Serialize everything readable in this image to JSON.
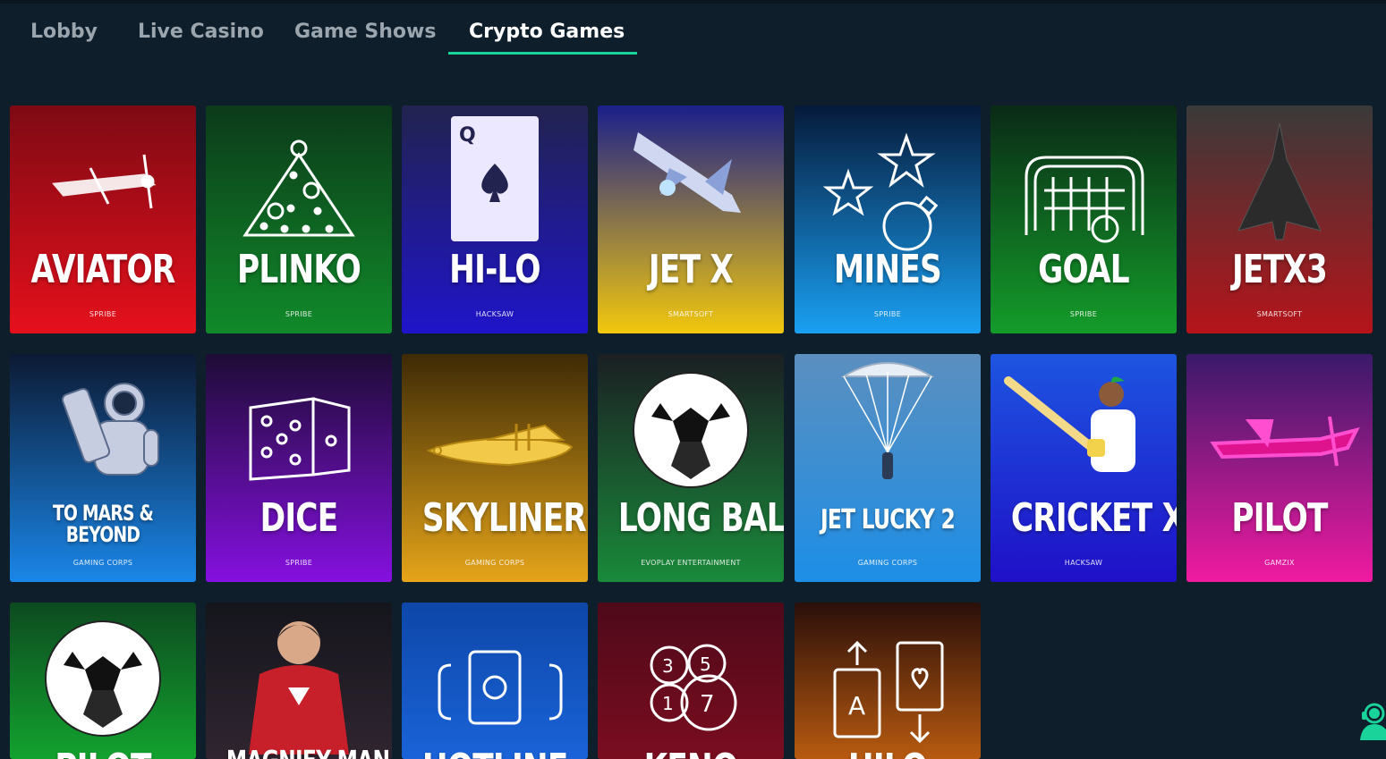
{
  "tabs": [
    {
      "label": "Lobby",
      "active": false
    },
    {
      "label": "Live Casino",
      "active": false
    },
    {
      "label": "Game Shows",
      "active": false
    },
    {
      "label": "Crypto Games",
      "active": true
    }
  ],
  "games": [
    {
      "title": "AVIATOR",
      "provider": "SPRIBE",
      "icon": "airplane-icon",
      "gradient": [
        "#7e0a14",
        "#e5101c"
      ]
    },
    {
      "title": "PLINKO",
      "provider": "SPRIBE",
      "icon": "triangle-balls-icon",
      "gradient": [
        "#0c3a1a",
        "#118a2a"
      ]
    },
    {
      "title": "HI-LO",
      "provider": "HACKSAW",
      "icon": "card-spade-icon",
      "gradient": [
        "#22234f",
        "#1f14c9"
      ]
    },
    {
      "title": "JET X",
      "provider": "SMARTSOFT",
      "icon": "jet-icon",
      "gradient": [
        "#1b1f8a",
        "#f2c80d"
      ]
    },
    {
      "title": "MINES",
      "provider": "SPRIBE",
      "icon": "stars-bomb-icon",
      "gradient": [
        "#061a3a",
        "#1aa0f2"
      ]
    },
    {
      "title": "GOAL",
      "provider": "SPRIBE",
      "icon": "goal-net-icon",
      "gradient": [
        "#0a2a16",
        "#149c2a"
      ]
    },
    {
      "title": "JETX3",
      "provider": "SMARTSOFT",
      "icon": "fighter-jet-icon",
      "gradient": [
        "#3a3a3a",
        "#b5141a"
      ]
    },
    {
      "title": "TO MARS & BEYOND",
      "provider": "GAMING CORPS",
      "icon": "astronaut-icon",
      "gradient": [
        "#0c1a33",
        "#1a86e8"
      ]
    },
    {
      "title": "DICE",
      "provider": "SPRIBE",
      "icon": "dice-icon",
      "gradient": [
        "#1e0c36",
        "#8510e0"
      ]
    },
    {
      "title": "SKYLINER",
      "provider": "GAMING CORPS",
      "icon": "plane-gold-icon",
      "gradient": [
        "#3d2a05",
        "#e6a51a"
      ]
    },
    {
      "title": "LONG BALL",
      "provider": "EVOPLAY ENTERTAINMENT",
      "icon": "soccer-ball-icon",
      "gradient": [
        "#1b1f23",
        "#1a8a3a"
      ]
    },
    {
      "title": "JET LUCKY 2",
      "provider": "GAMING CORPS",
      "icon": "parachute-icon",
      "gradient": [
        "#5b8fbf",
        "#1d8ee6"
      ]
    },
    {
      "title": "CRICKET X",
      "provider": "HACKSAW",
      "icon": "cricket-player-icon",
      "gradient": [
        "#1d55e0",
        "#1f10c8"
      ]
    },
    {
      "title": "PILOT",
      "provider": "GAMZIX",
      "icon": "neon-plane-icon",
      "gradient": [
        "#3a1a6a",
        "#f01aa0"
      ]
    },
    {
      "title": "PILOT",
      "provider": "",
      "icon": "soccer-ball-icon",
      "gradient": [
        "#0d4a20",
        "#13a22e"
      ]
    },
    {
      "title": "MAGNIFY MAN",
      "provider": "",
      "icon": "hero-icon",
      "gradient": [
        "#15151c",
        "#302530"
      ]
    },
    {
      "title": "HOTLINE",
      "provider": "",
      "icon": "slot-reels-icon",
      "gradient": [
        "#0d47a8",
        "#1a63d8"
      ]
    },
    {
      "title": "KENO",
      "provider": "",
      "icon": "keno-balls-icon",
      "gradient": [
        "#4e0a1a",
        "#7a0d20"
      ]
    },
    {
      "title": "HILO",
      "provider": "",
      "icon": "hilo-cards-icon",
      "gradient": [
        "#2a0f0a",
        "#b85a10"
      ]
    }
  ],
  "support": {
    "icon": "support-agent-icon",
    "color": "#19d39a"
  }
}
